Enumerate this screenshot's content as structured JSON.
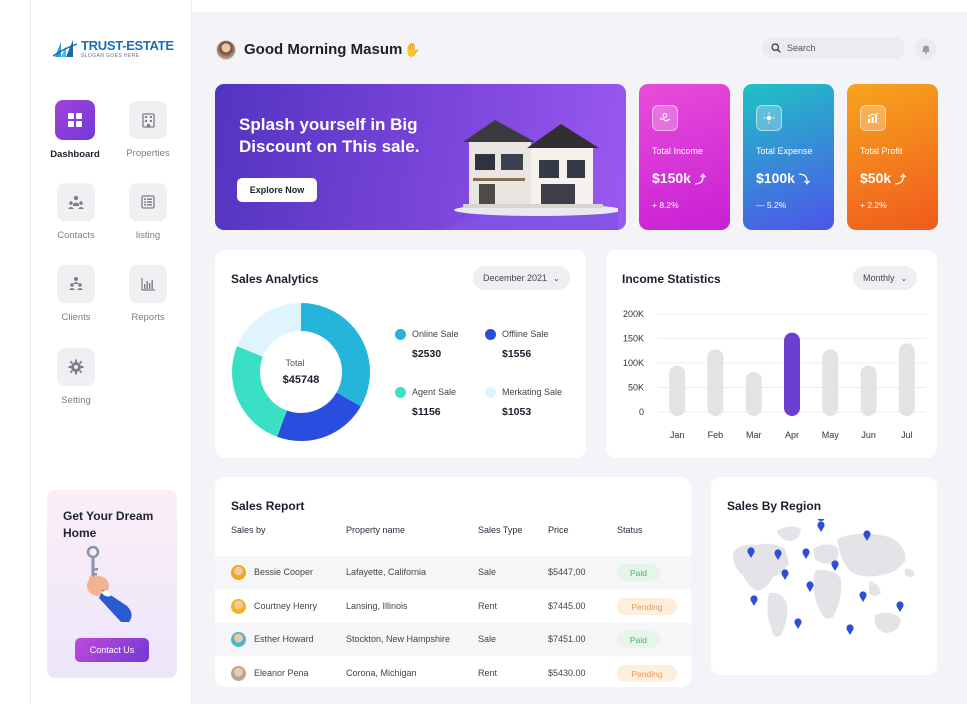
{
  "brand": {
    "name": "TRUST-ESTATE",
    "slogan": "SLOGAN GOES HERE"
  },
  "sidebar": {
    "items": [
      {
        "label": "Dashboard",
        "icon": "grid-icon",
        "active": true
      },
      {
        "label": "Properties",
        "icon": "building-icon",
        "active": false
      },
      {
        "label": "Contacts",
        "icon": "team-icon",
        "active": false
      },
      {
        "label": "listing",
        "icon": "list-icon",
        "active": false
      },
      {
        "label": "Clients",
        "icon": "people-icon",
        "active": false
      },
      {
        "label": "Reports",
        "icon": "report-chart-icon",
        "active": false
      },
      {
        "label": "Setting",
        "icon": "gear-icon",
        "active": false
      }
    ],
    "promo": {
      "title": "Get Your Dream Home",
      "button": "Contact Us"
    }
  },
  "header": {
    "greeting": "Good Morning Masum",
    "search_placeholder": "Search"
  },
  "banner": {
    "title": "Splash yourself in Big Discount on This sale.",
    "button": "Explore Now"
  },
  "stats": [
    {
      "label": "Total Income",
      "value": "$150k",
      "change": "+ 8.2%",
      "direction": "up",
      "gradient": [
        "#e84dd8",
        "#c81fd5"
      ]
    },
    {
      "label": "Total Expense",
      "value": "$100k",
      "change": "— 5.2%",
      "direction": "down",
      "gradient": [
        "#1fc2c4",
        "#4e54ea"
      ]
    },
    {
      "label": "Total Profit",
      "value": "$50k",
      "change": "+ 2.2%",
      "direction": "up",
      "gradient": [
        "#f7a51d",
        "#f05a1d"
      ]
    }
  ],
  "sales_analytics": {
    "title": "Sales Analytics",
    "period": "December 2021",
    "total_label": "Total",
    "total_value": "$45748",
    "legend": [
      {
        "label": "Online Sale",
        "value": "$2530",
        "color": "#25b4da"
      },
      {
        "label": "Offline Sale",
        "value": "$1556",
        "color": "#2a4de0"
      },
      {
        "label": "Agent Sale",
        "value": "$1156",
        "color": "#3ae0c4"
      },
      {
        "label": "Merkating Sale",
        "value": "$1053",
        "color": "#dff4fc"
      }
    ]
  },
  "income_statistics": {
    "title": "Income Statistics",
    "period": "Monthly"
  },
  "chart_data": {
    "type": "bar",
    "categories": [
      "Jan",
      "Feb",
      "Mar",
      "Apr",
      "May",
      "Jun",
      "Jul"
    ],
    "values": [
      95,
      128,
      82,
      162,
      128,
      95,
      140
    ],
    "highlight_index": 3,
    "ylim": [
      0,
      200
    ],
    "yticks": [
      "200K",
      "150K",
      "100K",
      "50K",
      "0"
    ],
    "grid": true,
    "colors": {
      "bar": "#e3e3e6",
      "highlight": "#6c3fd0"
    }
  },
  "sales_report": {
    "title": "Sales Report",
    "columns": [
      "Sales by",
      "Property name",
      "Sales Type",
      "Price",
      "Status"
    ],
    "rows": [
      {
        "name": "Bessie Cooper",
        "property": "Lafayette, California",
        "type": "Sale",
        "price": "$5447,00",
        "status": "Paid"
      },
      {
        "name": "Courtney Henry",
        "property": "Lansing, Illinois",
        "type": "Rent",
        "price": "$7445.00",
        "status": "Pending"
      },
      {
        "name": "Esther Howard",
        "property": "Stockton, New Hampshire",
        "type": "Sale",
        "price": "$7451.00",
        "status": "Paid"
      },
      {
        "name": "Eleanor Pena",
        "property": "Corona, Michigan",
        "type": "Rent",
        "price": "$5430.00",
        "status": "Pending"
      }
    ]
  },
  "sales_by_region": {
    "title": "Sales By Region"
  }
}
